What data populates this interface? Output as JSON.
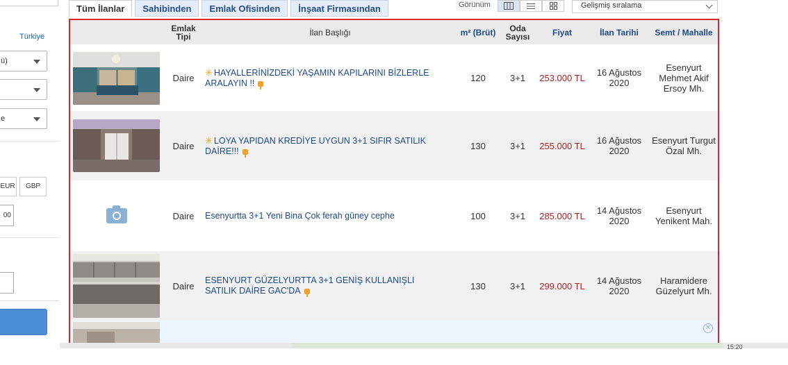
{
  "left_panel": {
    "country_link": "Türkiye",
    "select1_value": "ü)",
    "select3_value": "e",
    "currency_eur": "EUR",
    "currency_gbp": "GBP",
    "price_input": "00"
  },
  "tabs": [
    {
      "label": "Tüm İlanlar",
      "active": true
    },
    {
      "label": "Sahibinden",
      "active": false
    },
    {
      "label": "Emlak Ofisinden",
      "active": false
    },
    {
      "label": "İnşaat Firmasından",
      "active": false
    }
  ],
  "view": {
    "label": "Görünüm"
  },
  "sort": {
    "value": "Gelişmiş sıralama"
  },
  "table": {
    "headers": {
      "type": "Emlak Tipi",
      "title": "İlan Başlığı",
      "area": "m² (Brüt)",
      "rooms": "Oda Sayısı",
      "price": "Fiyat",
      "date": "İlan Tarihi",
      "location": "Semt / Mahalle"
    },
    "rows": [
      {
        "type": "Daire",
        "title": "HAYALLERİNİZDEKİ YAŞAMIN KAPILARINI BİZLERLE ARALAYIN !!",
        "featured": true,
        "area": "120",
        "rooms": "3+1",
        "price": "253.000 TL",
        "date": "16 Ağustos 2020",
        "location": "Esenyurt Mehmet Akif Ersoy Mh."
      },
      {
        "type": "Daire",
        "title": "LOYA YAPIDAN KREDİYE UYGUN 3+1 SIFIR SATILIK DAİRE!!!",
        "featured": true,
        "area": "130",
        "rooms": "3+1",
        "price": "255.000 TL",
        "date": "16 Ağustos 2020",
        "location": "Esenyurt Turgut Özal Mh."
      },
      {
        "type": "Daire",
        "title": "Esenyurtta 3+1 Yeni Bina Çok ferah güney cephe",
        "featured": false,
        "area": "100",
        "rooms": "3+1",
        "price": "285.000 TL",
        "date": "14 Ağustos 2020",
        "location": "Esenyurt Yenikent Mah."
      },
      {
        "type": "Daire",
        "title": "ESENYURT GÜZELYURTTA 3+1 GENİŞ KULLANIŞLI SATILIK DAİRE GAC'DA",
        "featured": false,
        "area": "130",
        "rooms": "3+1",
        "price": "299.000 TL",
        "date": "14 Ağustos 2020",
        "location": "Haramidere Güzelyurt Mh."
      }
    ]
  },
  "status": {
    "time": "15:20"
  }
}
